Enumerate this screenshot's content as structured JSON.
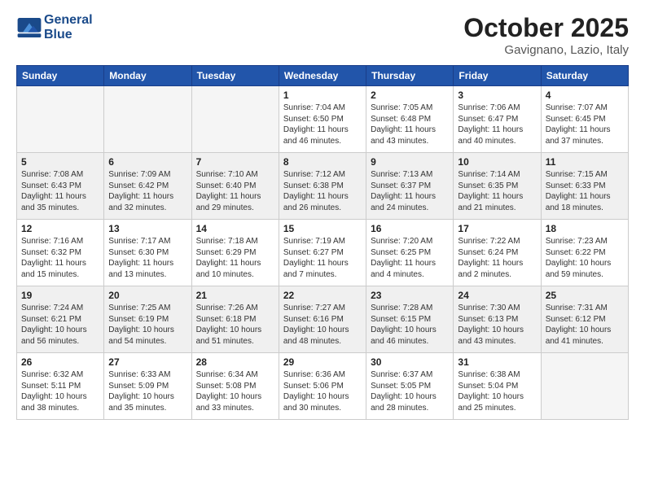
{
  "header": {
    "logo_line1": "General",
    "logo_line2": "Blue",
    "month": "October 2025",
    "location": "Gavignano, Lazio, Italy"
  },
  "weekdays": [
    "Sunday",
    "Monday",
    "Tuesday",
    "Wednesday",
    "Thursday",
    "Friday",
    "Saturday"
  ],
  "weeks": [
    [
      {
        "day": "",
        "info": ""
      },
      {
        "day": "",
        "info": ""
      },
      {
        "day": "",
        "info": ""
      },
      {
        "day": "1",
        "info": "Sunrise: 7:04 AM\nSunset: 6:50 PM\nDaylight: 11 hours\nand 46 minutes."
      },
      {
        "day": "2",
        "info": "Sunrise: 7:05 AM\nSunset: 6:48 PM\nDaylight: 11 hours\nand 43 minutes."
      },
      {
        "day": "3",
        "info": "Sunrise: 7:06 AM\nSunset: 6:47 PM\nDaylight: 11 hours\nand 40 minutes."
      },
      {
        "day": "4",
        "info": "Sunrise: 7:07 AM\nSunset: 6:45 PM\nDaylight: 11 hours\nand 37 minutes."
      }
    ],
    [
      {
        "day": "5",
        "info": "Sunrise: 7:08 AM\nSunset: 6:43 PM\nDaylight: 11 hours\nand 35 minutes."
      },
      {
        "day": "6",
        "info": "Sunrise: 7:09 AM\nSunset: 6:42 PM\nDaylight: 11 hours\nand 32 minutes."
      },
      {
        "day": "7",
        "info": "Sunrise: 7:10 AM\nSunset: 6:40 PM\nDaylight: 11 hours\nand 29 minutes."
      },
      {
        "day": "8",
        "info": "Sunrise: 7:12 AM\nSunset: 6:38 PM\nDaylight: 11 hours\nand 26 minutes."
      },
      {
        "day": "9",
        "info": "Sunrise: 7:13 AM\nSunset: 6:37 PM\nDaylight: 11 hours\nand 24 minutes."
      },
      {
        "day": "10",
        "info": "Sunrise: 7:14 AM\nSunset: 6:35 PM\nDaylight: 11 hours\nand 21 minutes."
      },
      {
        "day": "11",
        "info": "Sunrise: 7:15 AM\nSunset: 6:33 PM\nDaylight: 11 hours\nand 18 minutes."
      }
    ],
    [
      {
        "day": "12",
        "info": "Sunrise: 7:16 AM\nSunset: 6:32 PM\nDaylight: 11 hours\nand 15 minutes."
      },
      {
        "day": "13",
        "info": "Sunrise: 7:17 AM\nSunset: 6:30 PM\nDaylight: 11 hours\nand 13 minutes."
      },
      {
        "day": "14",
        "info": "Sunrise: 7:18 AM\nSunset: 6:29 PM\nDaylight: 11 hours\nand 10 minutes."
      },
      {
        "day": "15",
        "info": "Sunrise: 7:19 AM\nSunset: 6:27 PM\nDaylight: 11 hours\nand 7 minutes."
      },
      {
        "day": "16",
        "info": "Sunrise: 7:20 AM\nSunset: 6:25 PM\nDaylight: 11 hours\nand 4 minutes."
      },
      {
        "day": "17",
        "info": "Sunrise: 7:22 AM\nSunset: 6:24 PM\nDaylight: 11 hours\nand 2 minutes."
      },
      {
        "day": "18",
        "info": "Sunrise: 7:23 AM\nSunset: 6:22 PM\nDaylight: 10 hours\nand 59 minutes."
      }
    ],
    [
      {
        "day": "19",
        "info": "Sunrise: 7:24 AM\nSunset: 6:21 PM\nDaylight: 10 hours\nand 56 minutes."
      },
      {
        "day": "20",
        "info": "Sunrise: 7:25 AM\nSunset: 6:19 PM\nDaylight: 10 hours\nand 54 minutes."
      },
      {
        "day": "21",
        "info": "Sunrise: 7:26 AM\nSunset: 6:18 PM\nDaylight: 10 hours\nand 51 minutes."
      },
      {
        "day": "22",
        "info": "Sunrise: 7:27 AM\nSunset: 6:16 PM\nDaylight: 10 hours\nand 48 minutes."
      },
      {
        "day": "23",
        "info": "Sunrise: 7:28 AM\nSunset: 6:15 PM\nDaylight: 10 hours\nand 46 minutes."
      },
      {
        "day": "24",
        "info": "Sunrise: 7:30 AM\nSunset: 6:13 PM\nDaylight: 10 hours\nand 43 minutes."
      },
      {
        "day": "25",
        "info": "Sunrise: 7:31 AM\nSunset: 6:12 PM\nDaylight: 10 hours\nand 41 minutes."
      }
    ],
    [
      {
        "day": "26",
        "info": "Sunrise: 6:32 AM\nSunset: 5:11 PM\nDaylight: 10 hours\nand 38 minutes."
      },
      {
        "day": "27",
        "info": "Sunrise: 6:33 AM\nSunset: 5:09 PM\nDaylight: 10 hours\nand 35 minutes."
      },
      {
        "day": "28",
        "info": "Sunrise: 6:34 AM\nSunset: 5:08 PM\nDaylight: 10 hours\nand 33 minutes."
      },
      {
        "day": "29",
        "info": "Sunrise: 6:36 AM\nSunset: 5:06 PM\nDaylight: 10 hours\nand 30 minutes."
      },
      {
        "day": "30",
        "info": "Sunrise: 6:37 AM\nSunset: 5:05 PM\nDaylight: 10 hours\nand 28 minutes."
      },
      {
        "day": "31",
        "info": "Sunrise: 6:38 AM\nSunset: 5:04 PM\nDaylight: 10 hours\nand 25 minutes."
      },
      {
        "day": "",
        "info": ""
      }
    ]
  ]
}
